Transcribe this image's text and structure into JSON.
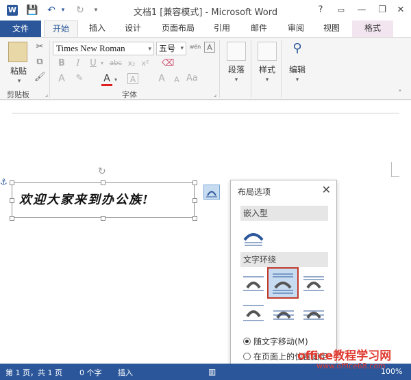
{
  "titlebar": {
    "title": "文档1 [兼容模式] - Microsoft Word",
    "logo": "W",
    "help": "?",
    "minimize": "—",
    "restore": "❐",
    "close": "✕"
  },
  "tabs": [
    {
      "label": "文件"
    },
    {
      "label": "开始"
    },
    {
      "label": "插入"
    },
    {
      "label": "设计"
    },
    {
      "label": "页面布局"
    },
    {
      "label": "引用"
    },
    {
      "label": "邮件"
    },
    {
      "label": "审阅"
    },
    {
      "label": "视图"
    },
    {
      "label": "格式"
    }
  ],
  "ribbon": {
    "paste_label": "粘贴",
    "clipboard_label": "剪贴板",
    "font_name": "Times New Roman",
    "font_size": "五号",
    "font_group_label": "字体",
    "paragraph_label": "段落",
    "styles_label": "样式",
    "editing_label": "编辑",
    "bold": "B",
    "italic": "I",
    "underline": "U",
    "strike": "abc",
    "subscript": "x₂",
    "superscript": "x²",
    "font_color": "A",
    "wen": "wén",
    "grow": "A",
    "shrink": "A"
  },
  "document": {
    "textbox_text": "欢迎大家来到办公族!"
  },
  "layout_panel": {
    "title": "布局选项",
    "close": "✕",
    "inline_section": "嵌入型",
    "wrap_section": "文字环绕",
    "move_with_text": "随文字移动(M)",
    "fix_position": "在页面上的位置固定(N)"
  },
  "status": {
    "page": "第 1 页，共 1 页",
    "words": "0 个字",
    "mode": "插入",
    "zoom": "100%"
  },
  "watermark": {
    "text": "office教程学习网",
    "url": "www.office68.com"
  }
}
